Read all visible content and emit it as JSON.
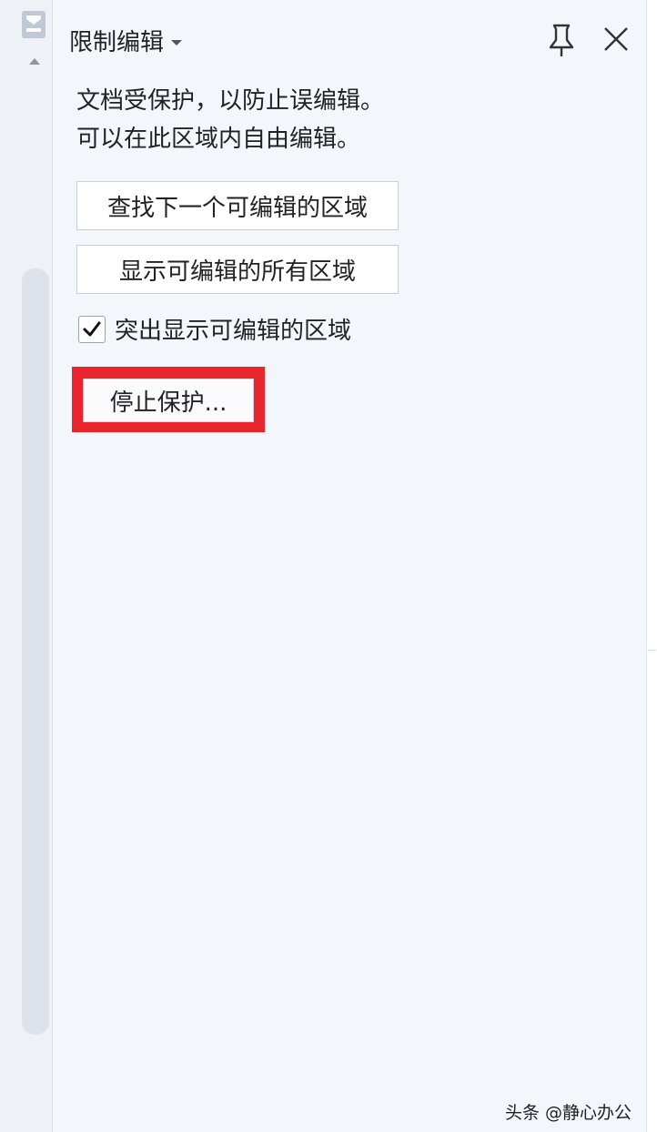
{
  "panel": {
    "title": "限制编辑",
    "description_line1": "文档受保护，以防止误编辑。",
    "description_line2": "可以在此区域内自由编辑。",
    "find_next_label": "查找下一个可编辑的区域",
    "show_all_label": "显示可编辑的所有区域",
    "highlight_checkbox_label": "突出显示可编辑的区域",
    "highlight_checked": true,
    "stop_protection_label": "停止保护..."
  },
  "icons": {
    "title_dropdown": "chevron-down-icon",
    "pin": "pin-icon",
    "close": "close-icon",
    "strip": "bookmark-icon",
    "scroll_up": "scroll-up-arrow-icon"
  },
  "annotation": {
    "highlight_color": "#e8242c"
  },
  "watermark": {
    "text": "头条 @静心办公"
  }
}
